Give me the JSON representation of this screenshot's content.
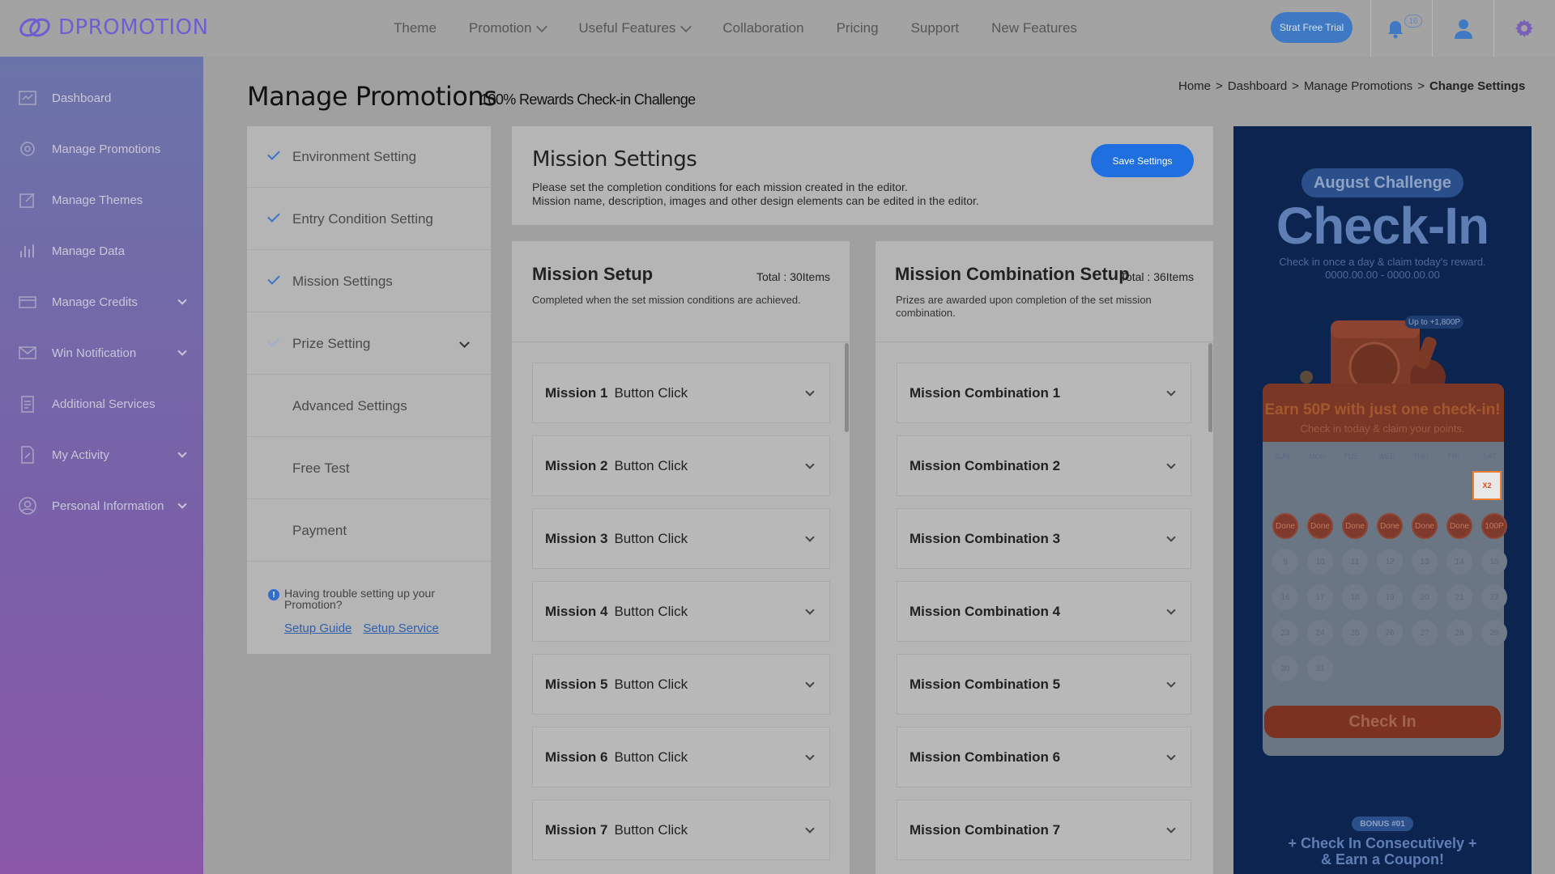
{
  "brand": {
    "name": "DPROMOTION"
  },
  "nav": [
    {
      "label": "Theme",
      "dropdown": false
    },
    {
      "label": "Promotion",
      "dropdown": true
    },
    {
      "label": "Useful Features",
      "dropdown": true
    },
    {
      "label": "Collaboration",
      "dropdown": false
    },
    {
      "label": "Pricing",
      "dropdown": false
    },
    {
      "label": "Support",
      "dropdown": false
    },
    {
      "label": "New Features",
      "dropdown": false
    }
  ],
  "topbar": {
    "trial_label": "Strat Free Trial",
    "notification_count": "16"
  },
  "sidebar": {
    "items": [
      {
        "label": "Dashboard",
        "icon": "dashboard-icon",
        "dropdown": false
      },
      {
        "label": "Manage Promotions",
        "icon": "gear-icon",
        "dropdown": false
      },
      {
        "label": "Manage Themes",
        "icon": "edit-icon",
        "dropdown": false
      },
      {
        "label": "Manage Data",
        "icon": "bar-chart-icon",
        "dropdown": false
      },
      {
        "label": "Manage Credits",
        "icon": "credit-card-icon",
        "dropdown": true
      },
      {
        "label": "Win Notification",
        "icon": "mail-icon",
        "dropdown": true
      },
      {
        "label": "Additional Services",
        "icon": "clipboard-icon",
        "dropdown": false
      },
      {
        "label": "My Activity",
        "icon": "document-edit-icon",
        "dropdown": true
      },
      {
        "label": "Personal Information",
        "icon": "user-circle-icon",
        "dropdown": true
      }
    ]
  },
  "page": {
    "title": "Manage Promotions",
    "subtitle": "100% Rewards Check-in Challenge"
  },
  "breadcrumb": {
    "items": [
      "Home",
      "Dashboard",
      "Manage Promotions"
    ],
    "current": "Change Settings",
    "separator": ">"
  },
  "steps": [
    {
      "label": "Environment Setting",
      "checked": true
    },
    {
      "label": "Entry Condition Setting",
      "checked": true
    },
    {
      "label": "Mission Settings",
      "checked": true
    },
    {
      "label": "Prize Setting",
      "checked": "light",
      "dropdown": true
    },
    {
      "label": "Advanced Settings",
      "checked": false
    },
    {
      "label": "Free Test",
      "checked": false
    },
    {
      "label": "Payment",
      "checked": false
    }
  ],
  "help": {
    "text": "Having trouble setting up your Promotion?",
    "link1": "Setup Guide",
    "link2": "Setup Service"
  },
  "mission_settings": {
    "title": "Mission Settings",
    "desc_line1": "Please set the completion conditions for each mission created in the editor.",
    "desc_line2": "Mission name, description, images and other design elements can be edited in the editor.",
    "save_label": "Save Settings"
  },
  "mission_setup": {
    "title": "Mission Setup",
    "total": "Total : 30Items",
    "desc": "Completed when the set mission conditions are achieved.",
    "items": [
      {
        "name": "Mission 1",
        "type": "Button Click"
      },
      {
        "name": "Mission 2",
        "type": "Button Click"
      },
      {
        "name": "Mission 3",
        "type": "Button Click"
      },
      {
        "name": "Mission 4",
        "type": "Button Click"
      },
      {
        "name": "Mission 5",
        "type": "Button Click"
      },
      {
        "name": "Mission 6",
        "type": "Button Click"
      },
      {
        "name": "Mission 7",
        "type": "Button Click"
      }
    ]
  },
  "combination_setup": {
    "title": "Mission Combination Setup",
    "total": "Total : 36Items",
    "desc": "Prizes are awarded upon completion of the set mission combination.",
    "items": [
      "Mission Combination 1",
      "Mission Combination 2",
      "Mission Combination 3",
      "Mission Combination 4",
      "Mission Combination 5",
      "Mission Combination 6",
      "Mission Combination 7"
    ]
  },
  "preview": {
    "tag": "August Challenge",
    "headline": "Check-In",
    "sub1": "Check in once a day & claim today's reward.",
    "sub2": "0000.00.00 - 0000.00.00",
    "upto": "Up to +1,800P",
    "earn": "Earn 50P with just one check-in!",
    "earn_sub": "Check in today & claim your points.",
    "days": [
      "SUN",
      "MON",
      "TUE",
      "WED",
      "THU",
      "FRI",
      "SAT"
    ],
    "done_label": "Done",
    "x2_label": "X2",
    "points_label": "100P",
    "checkin_label": "Check In",
    "bonus_tag": "BONUS #01",
    "bonus_line1": "+ Check In Consecutively +",
    "bonus_line2": "& Earn a Coupon!",
    "colors": {
      "bg": "#0c2550",
      "accent": "#7c3220"
    }
  }
}
